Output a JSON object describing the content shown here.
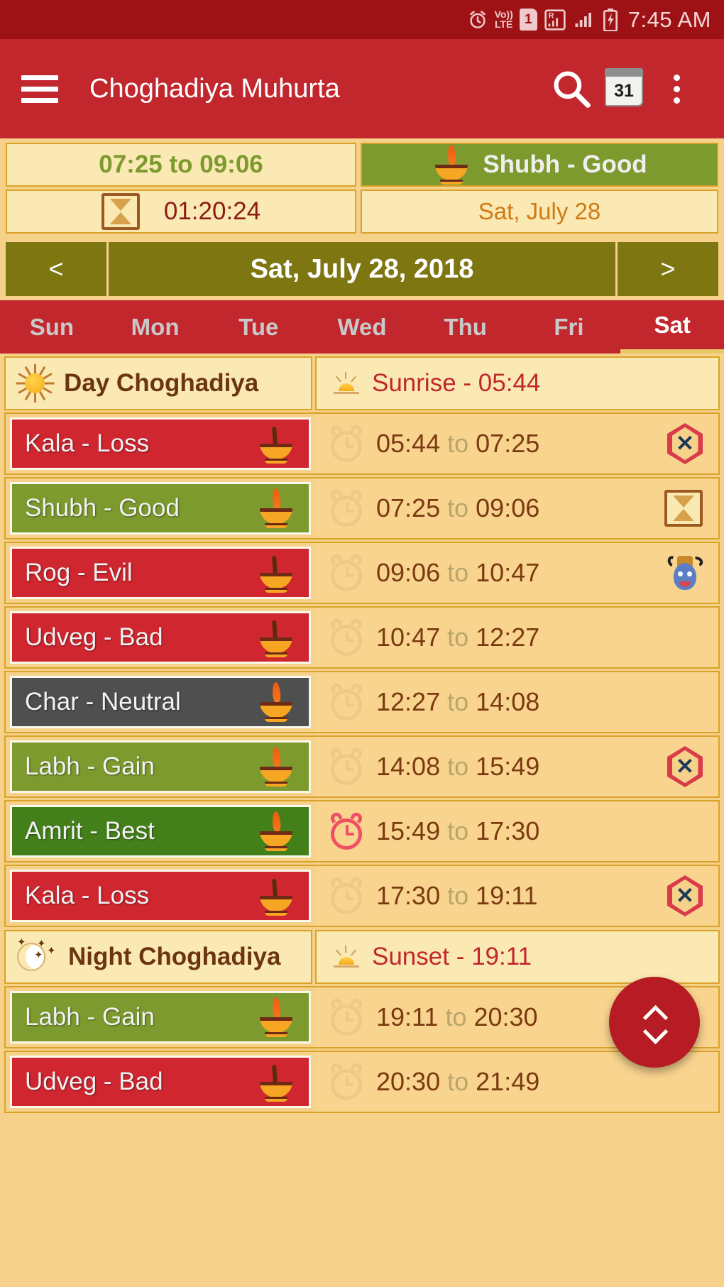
{
  "statusbar": {
    "icons": [
      "alarm-icon",
      "volte-icon",
      "sim1-icon",
      "roaming-signal-icon",
      "signal-icon",
      "battery-charging-icon"
    ],
    "volte_top": "Vo))",
    "volte_bottom": "LTE",
    "sim_label": "1",
    "roaming_label": "R",
    "time": "7:45 AM"
  },
  "appbar": {
    "menu_icon": "hamburger-menu-icon",
    "title": "Choghadiya Muhurta",
    "search_icon": "search-icon",
    "calendar_icon": "calendar-icon",
    "calendar_day": "31",
    "overflow_icon": "more-options-icon"
  },
  "info": {
    "current_range": "07:25 to 09:06",
    "countdown_icon": "hourglass-icon",
    "countdown": "01:20:24",
    "status_icon": "diya-lamp-icon",
    "status_label": "Shubh - Good",
    "status_color": "#7d9a2e",
    "date_short": "Sat, July 28"
  },
  "datenav": {
    "prev": "<",
    "current": "Sat, July 28, 2018",
    "next": ">"
  },
  "weekdays": [
    {
      "label": "Sun",
      "active": false
    },
    {
      "label": "Mon",
      "active": false
    },
    {
      "label": "Tue",
      "active": false
    },
    {
      "label": "Wed",
      "active": false
    },
    {
      "label": "Thu",
      "active": false
    },
    {
      "label": "Fri",
      "active": false
    },
    {
      "label": "Sat",
      "active": true
    }
  ],
  "day_section": {
    "icon": "sun-icon",
    "title": "Day Choghadiya",
    "sub_icon": "sunrise-icon",
    "sub_label": "Sunrise - 05:44"
  },
  "night_section": {
    "icon": "moon-stars-icon",
    "title": "Night Choghadiya",
    "sub_icon": "sunset-icon",
    "sub_label": "Sunset - 19:11"
  },
  "day_rows": [
    {
      "label": "Kala - Loss",
      "color": "#d02630",
      "lamp": "diya-unlit-icon",
      "start": "05:44",
      "to": "to",
      "end": "07:25",
      "alarm": "alarm-off-icon",
      "end_icon": "forbidden-icon"
    },
    {
      "label": "Shubh - Good",
      "color": "#7d9a2e",
      "lamp": "diya-lit-icon",
      "start": "07:25",
      "to": "to",
      "end": "09:06",
      "alarm": "alarm-off-icon",
      "end_icon": "hourglass-icon"
    },
    {
      "label": "Rog - Evil",
      "color": "#d02630",
      "lamp": "diya-unlit-icon",
      "start": "09:06",
      "to": "to",
      "end": "10:47",
      "alarm": "alarm-off-icon",
      "end_icon": "demon-icon"
    },
    {
      "label": "Udveg - Bad",
      "color": "#d02630",
      "lamp": "diya-unlit-icon",
      "start": "10:47",
      "to": "to",
      "end": "12:27",
      "alarm": "alarm-off-icon",
      "end_icon": ""
    },
    {
      "label": "Char - Neutral",
      "color": "#4f4f4f",
      "lamp": "diya-lit-icon",
      "start": "12:27",
      "to": "to",
      "end": "14:08",
      "alarm": "alarm-off-icon",
      "end_icon": ""
    },
    {
      "label": "Labh - Gain",
      "color": "#7d9a2e",
      "lamp": "diya-lit-icon",
      "start": "14:08",
      "to": "to",
      "end": "15:49",
      "alarm": "alarm-off-icon",
      "end_icon": "forbidden-icon"
    },
    {
      "label": "Amrit - Best",
      "color": "#44801a",
      "lamp": "diya-lit-icon",
      "start": "15:49",
      "to": "to",
      "end": "17:30",
      "alarm": "alarm-on-icon",
      "end_icon": ""
    },
    {
      "label": "Kala - Loss",
      "color": "#d02630",
      "lamp": "diya-unlit-icon",
      "start": "17:30",
      "to": "to",
      "end": "19:11",
      "alarm": "alarm-off-icon",
      "end_icon": "forbidden-icon"
    }
  ],
  "night_rows": [
    {
      "label": "Labh - Gain",
      "color": "#7d9a2e",
      "lamp": "diya-lit-icon",
      "start": "19:11",
      "to": "to",
      "end": "20:30",
      "alarm": "alarm-off-icon",
      "end_icon": ""
    },
    {
      "label": "Udveg - Bad",
      "color": "#d02630",
      "lamp": "diya-unlit-icon",
      "start": "20:30",
      "to": "to",
      "end": "21:49",
      "alarm": "alarm-off-icon",
      "end_icon": ""
    }
  ],
  "fab": {
    "name": "scroll-toggle-fab",
    "up_icon": "chevron-up-icon",
    "down_icon": "chevron-down-icon"
  }
}
